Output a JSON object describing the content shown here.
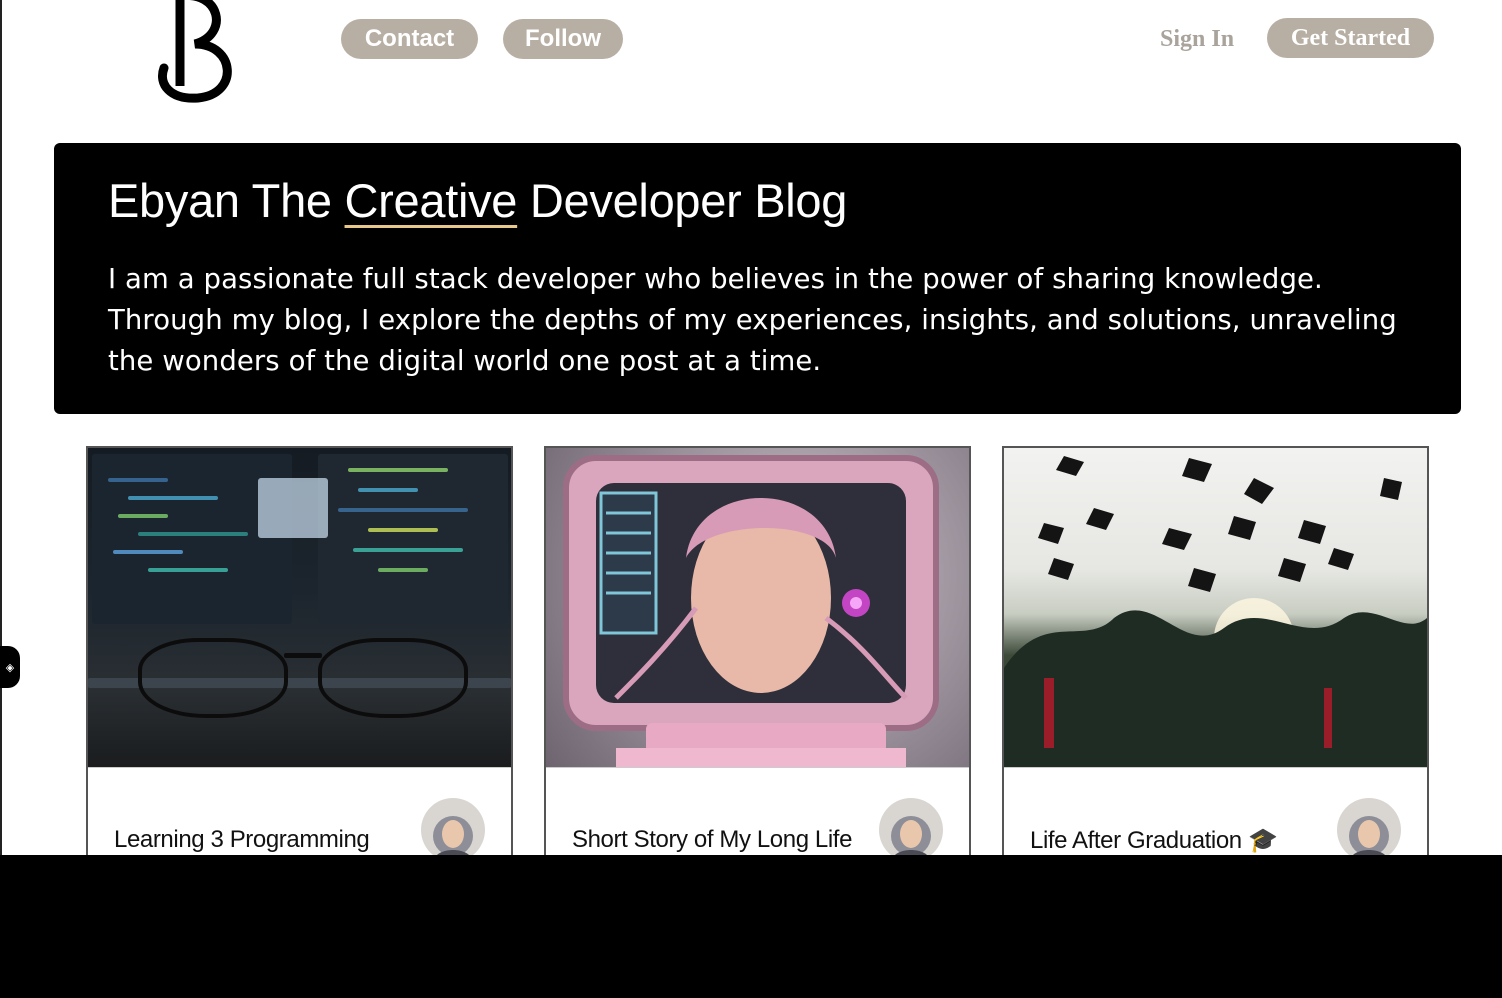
{
  "nav": {
    "contact_label": "Contact",
    "follow_label": "Follow",
    "sign_in_label": "Sign In",
    "get_started_label": "Get Started"
  },
  "hero": {
    "title_before": "Ebyan The ",
    "title_highlight": "Creative",
    "title_after": " Developer Blog",
    "description": "I am a passionate full stack developer who believes in the power of sharing knowledge. Through my blog, I explore the depths of my experiences, insights, and solutions, unraveling the wonders of the digital world one post at a time."
  },
  "posts": [
    {
      "title": "Learning 3 Programming",
      "image": "code-screens"
    },
    {
      "title": "Short Story of My Long Life",
      "image": "pink-computer"
    },
    {
      "title": "Life After Graduation 🎓",
      "image": "graduation-caps"
    }
  ],
  "colors": {
    "pill_bg": "#b8afa4",
    "hero_bg": "#000000",
    "highlight_underline": "#e8c88a",
    "sign_in_text": "#a9a39c"
  }
}
